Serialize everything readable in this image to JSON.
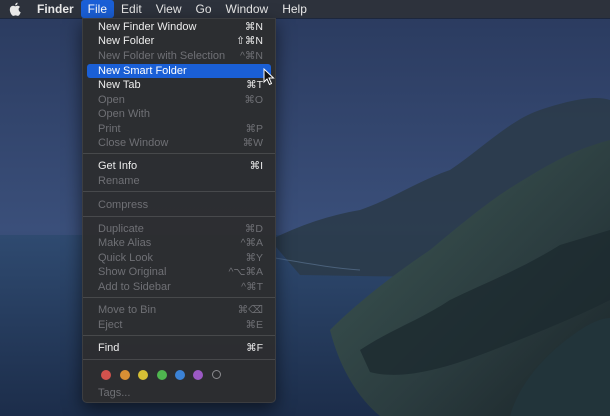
{
  "menubar": {
    "items": [
      {
        "label": "Finder"
      },
      {
        "label": "File"
      },
      {
        "label": "Edit"
      },
      {
        "label": "View"
      },
      {
        "label": "Go"
      },
      {
        "label": "Window"
      },
      {
        "label": "Help"
      }
    ]
  },
  "file_menu": {
    "items": [
      {
        "label": "New Finder Window",
        "shortcut": "⌘N",
        "enabled": true
      },
      {
        "label": "New Folder",
        "shortcut": "⇧⌘N",
        "enabled": true
      },
      {
        "label": "New Folder with Selection",
        "shortcut": "^⌘N",
        "enabled": false
      },
      {
        "label": "New Smart Folder",
        "shortcut": "",
        "enabled": true,
        "highlighted": true
      },
      {
        "label": "New Tab",
        "shortcut": "⌘T",
        "enabled": true
      },
      {
        "label": "Open",
        "shortcut": "⌘O",
        "enabled": false
      },
      {
        "label": "Open With",
        "shortcut": "",
        "enabled": false
      },
      {
        "label": "Print",
        "shortcut": "⌘P",
        "enabled": false
      },
      {
        "label": "Close Window",
        "shortcut": "⌘W",
        "enabled": false
      },
      {
        "label": "Get Info",
        "shortcut": "⌘I",
        "enabled": true
      },
      {
        "label": "Rename",
        "shortcut": "",
        "enabled": false
      },
      {
        "label": "Compress",
        "shortcut": "",
        "enabled": false
      },
      {
        "label": "Duplicate",
        "shortcut": "⌘D",
        "enabled": false
      },
      {
        "label": "Make Alias",
        "shortcut": "^⌘A",
        "enabled": false
      },
      {
        "label": "Quick Look",
        "shortcut": "⌘Y",
        "enabled": false
      },
      {
        "label": "Show Original",
        "shortcut": "^⌥⌘A",
        "enabled": false
      },
      {
        "label": "Add to Sidebar",
        "shortcut": "^⌘T",
        "enabled": false
      },
      {
        "label": "Move to Bin",
        "shortcut": "⌘⌫",
        "enabled": false
      },
      {
        "label": "Eject",
        "shortcut": "⌘E",
        "enabled": false
      },
      {
        "label": "Find",
        "shortcut": "⌘F",
        "enabled": true
      }
    ],
    "tag_colors": [
      "#d2524d",
      "#d88f34",
      "#d6bf35",
      "#4fb64f",
      "#3b82d6",
      "#9b59c4"
    ],
    "tags_label": "Tags..."
  }
}
